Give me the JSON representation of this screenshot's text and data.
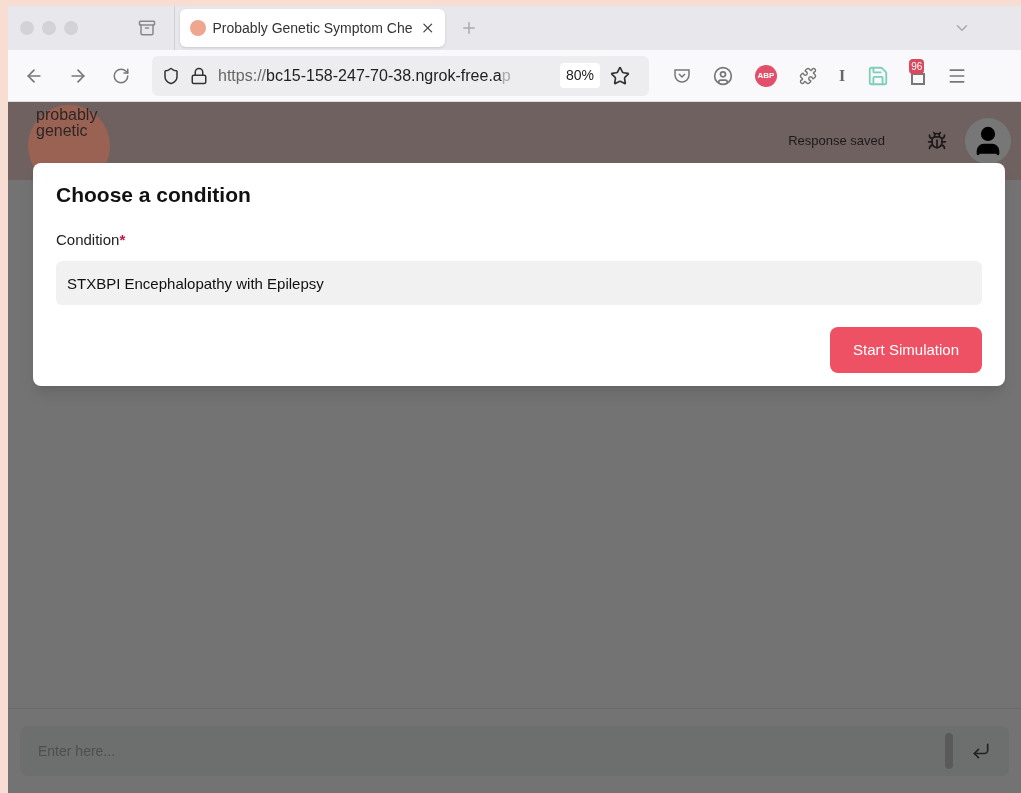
{
  "browser": {
    "tab": {
      "title": "Probably Genetic Symptom Che",
      "selected": true
    },
    "url": {
      "scheme": "https://",
      "host": "bc15-158-247-70-38.ngrok-free.a",
      "rest": "p"
    },
    "zoom": "80%",
    "extensions": {
      "abp": "ABP",
      "reader": "I",
      "badge": "96"
    }
  },
  "header": {
    "logo": [
      "probably",
      "genetic"
    ],
    "status": "Response saved"
  },
  "modal": {
    "title": "Choose a condition",
    "field": {
      "label": "Condition",
      "required_mark": "*",
      "value": "STXBPI Encephalopathy with Epilepsy"
    },
    "button": "Start Simulation"
  },
  "chat": {
    "placeholder": "Enter here..."
  }
}
